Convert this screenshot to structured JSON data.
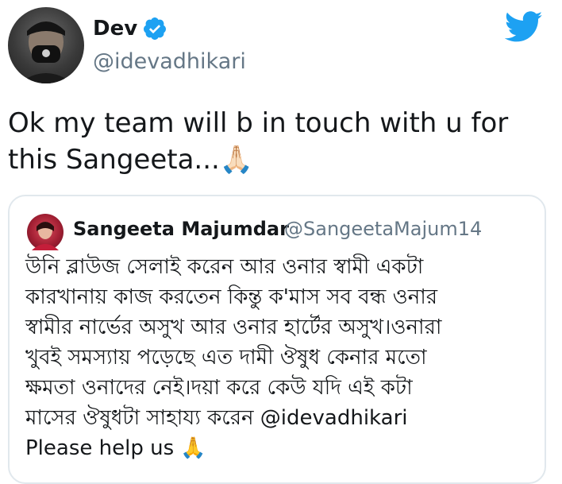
{
  "author": {
    "name": "Dev",
    "handle": "@idevadhikari",
    "verified": true,
    "avatar_icon": "profile-photo-masked"
  },
  "brand": {
    "icon": "twitter-bird-icon",
    "color": "#1da1f2"
  },
  "tweet": {
    "line1": "Ok my team will b in touch with u for",
    "line2": "this Sangeeta...",
    "emoji": "🙏🏻"
  },
  "quoted": {
    "name": "Sangeeta Majumdar",
    "handle": "@SangeetaMajum14",
    "lines": [
      "উনি ব্লাউজ সেলাই করেন আর ওনার স্বামী একটা",
      "কারখানায় কাজ করতেন কিন্তু ক'মাস সব বন্ধ ওনার",
      "স্বামীর নার্ভের অসুখ আর ওনার হার্টের অসুখ।ওনারা",
      "খুবই সমস্যায় পড়েছে এত দামী ঔষুধ কেনার মতো",
      "ক্ষমতা ওনাদের নেই।দয়া করে কেউ যদি এই কটা",
      "মাসের ঔষুধটা সাহায্য করেন @idevadhikari",
      "Please help us 🙏"
    ]
  }
}
